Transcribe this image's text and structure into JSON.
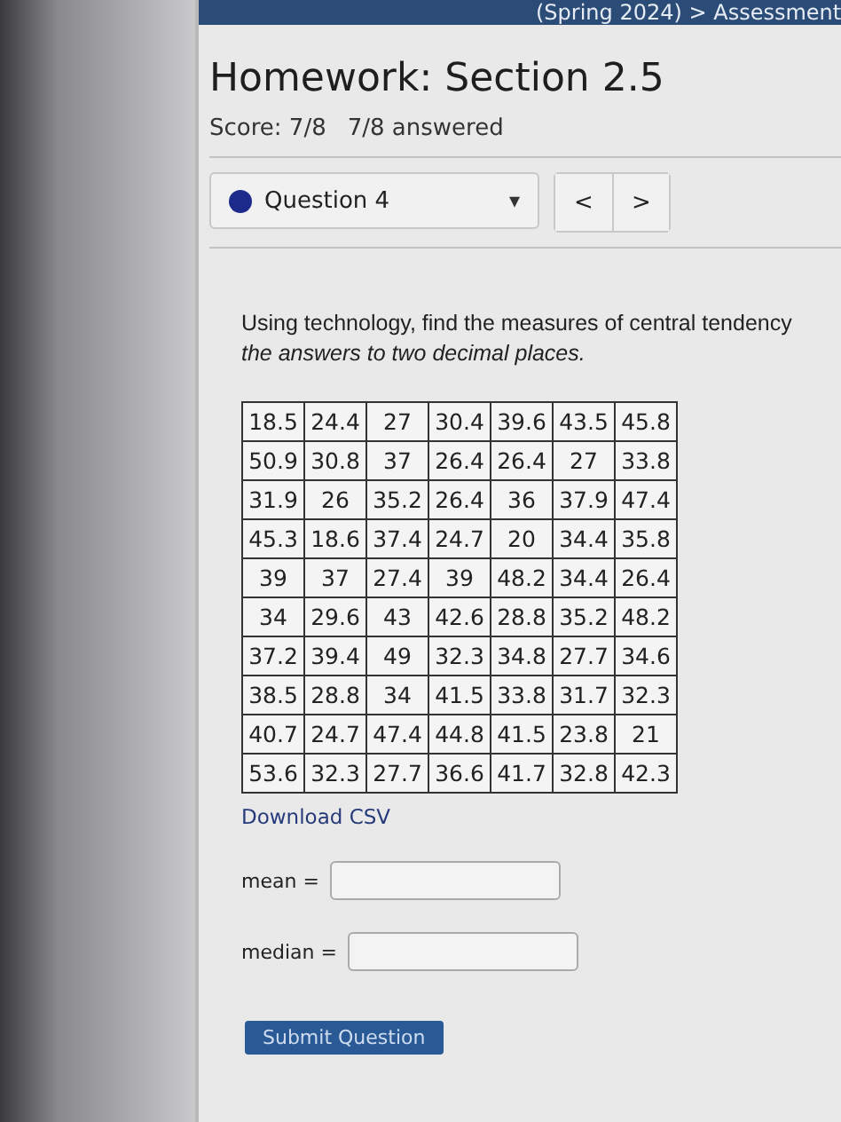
{
  "breadcrumb": "(Spring 2024) > Assessment",
  "title": "Homework: Section 2.5",
  "score": "Score: 7/8",
  "answered": "7/8 answered",
  "question_selector": {
    "label": "Question 4",
    "caret": "▾",
    "color": "#1c2a8c"
  },
  "nav_buttons": [
    "<",
    ">"
  ],
  "question": {
    "line_1": "Using technology, find the measures of central tendency",
    "line_2": "the answers to two decimal places."
  },
  "table": {
    "rows": [
      [
        "18.5",
        "24.4",
        "27",
        "30.4",
        "39.6",
        "43.5",
        "45.8"
      ],
      [
        "50.9",
        "30.8",
        "37",
        "26.4",
        "26.4",
        "27",
        "33.8"
      ],
      [
        "31.9",
        "26",
        "35.2",
        "26.4",
        "36",
        "37.9",
        "47.4"
      ],
      [
        "45.3",
        "18.6",
        "37.4",
        "24.7",
        "20",
        "34.4",
        "35.8"
      ],
      [
        "39",
        "37",
        "27.4",
        "39",
        "48.2",
        "34.4",
        "26.4"
      ],
      [
        "34",
        "29.6",
        "43",
        "42.6",
        "28.8",
        "35.2",
        "48.2"
      ],
      [
        "37.2",
        "39.4",
        "49",
        "32.3",
        "34.8",
        "27.7",
        "34.6"
      ],
      [
        "38.5",
        "28.8",
        "34",
        "41.5",
        "33.8",
        "31.7",
        "32.3"
      ],
      [
        "40.7",
        "24.7",
        "47.4",
        "44.8",
        "41.5",
        "23.8",
        "21"
      ],
      [
        "53.6",
        "32.3",
        "27.7",
        "36.6",
        "41.7",
        "32.8",
        "42.3"
      ]
    ]
  },
  "download_link": "Download CSV",
  "answers": [
    {
      "label": "mean ="
    },
    {
      "label": "median ="
    }
  ],
  "submit_button": "Submit Question"
}
